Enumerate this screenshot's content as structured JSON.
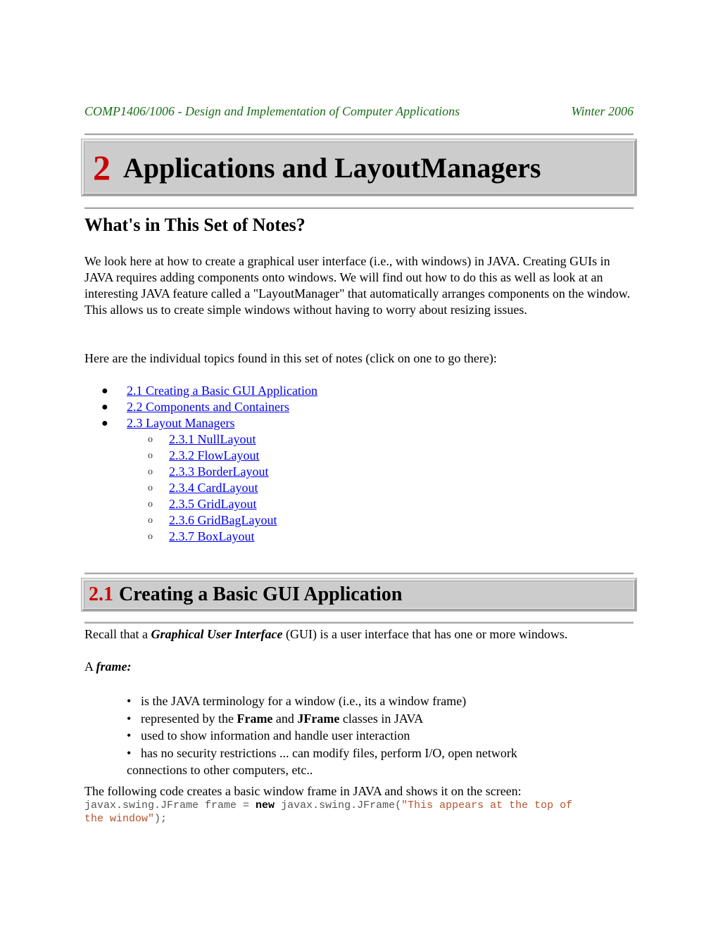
{
  "running_header": {
    "course": "COMP1406/1006 - Design and Implementation of Computer Applications",
    "term": "Winter 2006"
  },
  "chapter": {
    "number": "2",
    "title": "Applications and LayoutManagers"
  },
  "intro": {
    "heading": "What's in This Set of Notes?",
    "paragraph": "We look here at how to create a graphical user interface (i.e., with windows) in JAVA.   Creating GUIs in JAVA requires adding components onto windows.   We will find out how to do this as well as look at an interesting JAVA feature called a \"LayoutManager\" that automatically arranges components on the window.   This allows us to create simple windows without having to worry about resizing issues.",
    "toc_intro": "Here are the individual topics found in this set of notes (click on one to go there):"
  },
  "toc": [
    {
      "label": "2.1 Creating a Basic GUI Application",
      "level": 1
    },
    {
      "label": "2.2 Components and Containers",
      "level": 1
    },
    {
      "label": "2.3 Layout Managers",
      "level": 1
    },
    {
      "label": "2.3.1 NullLayout",
      "level": 2
    },
    {
      "label": "2.3.2 FlowLayout",
      "level": 2
    },
    {
      "label": "2.3.3 BorderLayout",
      "level": 2
    },
    {
      "label": "2.3.4 CardLayout",
      "level": 2
    },
    {
      "label": "2.3.5 GridLayout",
      "level": 2
    },
    {
      "label": "2.3.6 GridBagLayout",
      "level": 2
    },
    {
      "label": "2.3.7 BoxLayout",
      "level": 2
    }
  ],
  "section": {
    "number": "2.1",
    "title": "Creating a Basic GUI Application",
    "recall_prefix": "Recall that a ",
    "recall_term": "Graphical User Interface",
    "recall_suffix": " (GUI) is a user interface that has one or more windows.",
    "frame_prefix": "A ",
    "frame_term": "frame:",
    "bullets": {
      "b1": "is the JAVA terminology for a window (i.e., its a window frame)",
      "b2_prefix": "represented by the ",
      "b2_frame": "Frame",
      "b2_mid": " and ",
      "b2_jframe": "JFrame",
      "b2_suffix": " classes in JAVA",
      "b3": "used to show information and handle user interaction",
      "b4_line1": "has no security restrictions ... can modify files, perform I/O, open network",
      "b4_line2": "connections to other computers, etc.."
    },
    "code_intro": "The following code creates a basic window frame in JAVA and shows it on the screen:",
    "code": {
      "part1": "javax.swing.JFrame frame = ",
      "keyword": "new",
      "part2": " javax.swing.JFrame(",
      "string_line1": "\"This appears at the top of",
      "string_line2": "the window\"",
      "end": ");"
    }
  },
  "colors": {
    "header_green": "#1a6e1a",
    "number_red": "#cc0000",
    "link_blue": "#0000ee",
    "heading_bg": "#cccccc",
    "code_string": "#b5532b"
  }
}
